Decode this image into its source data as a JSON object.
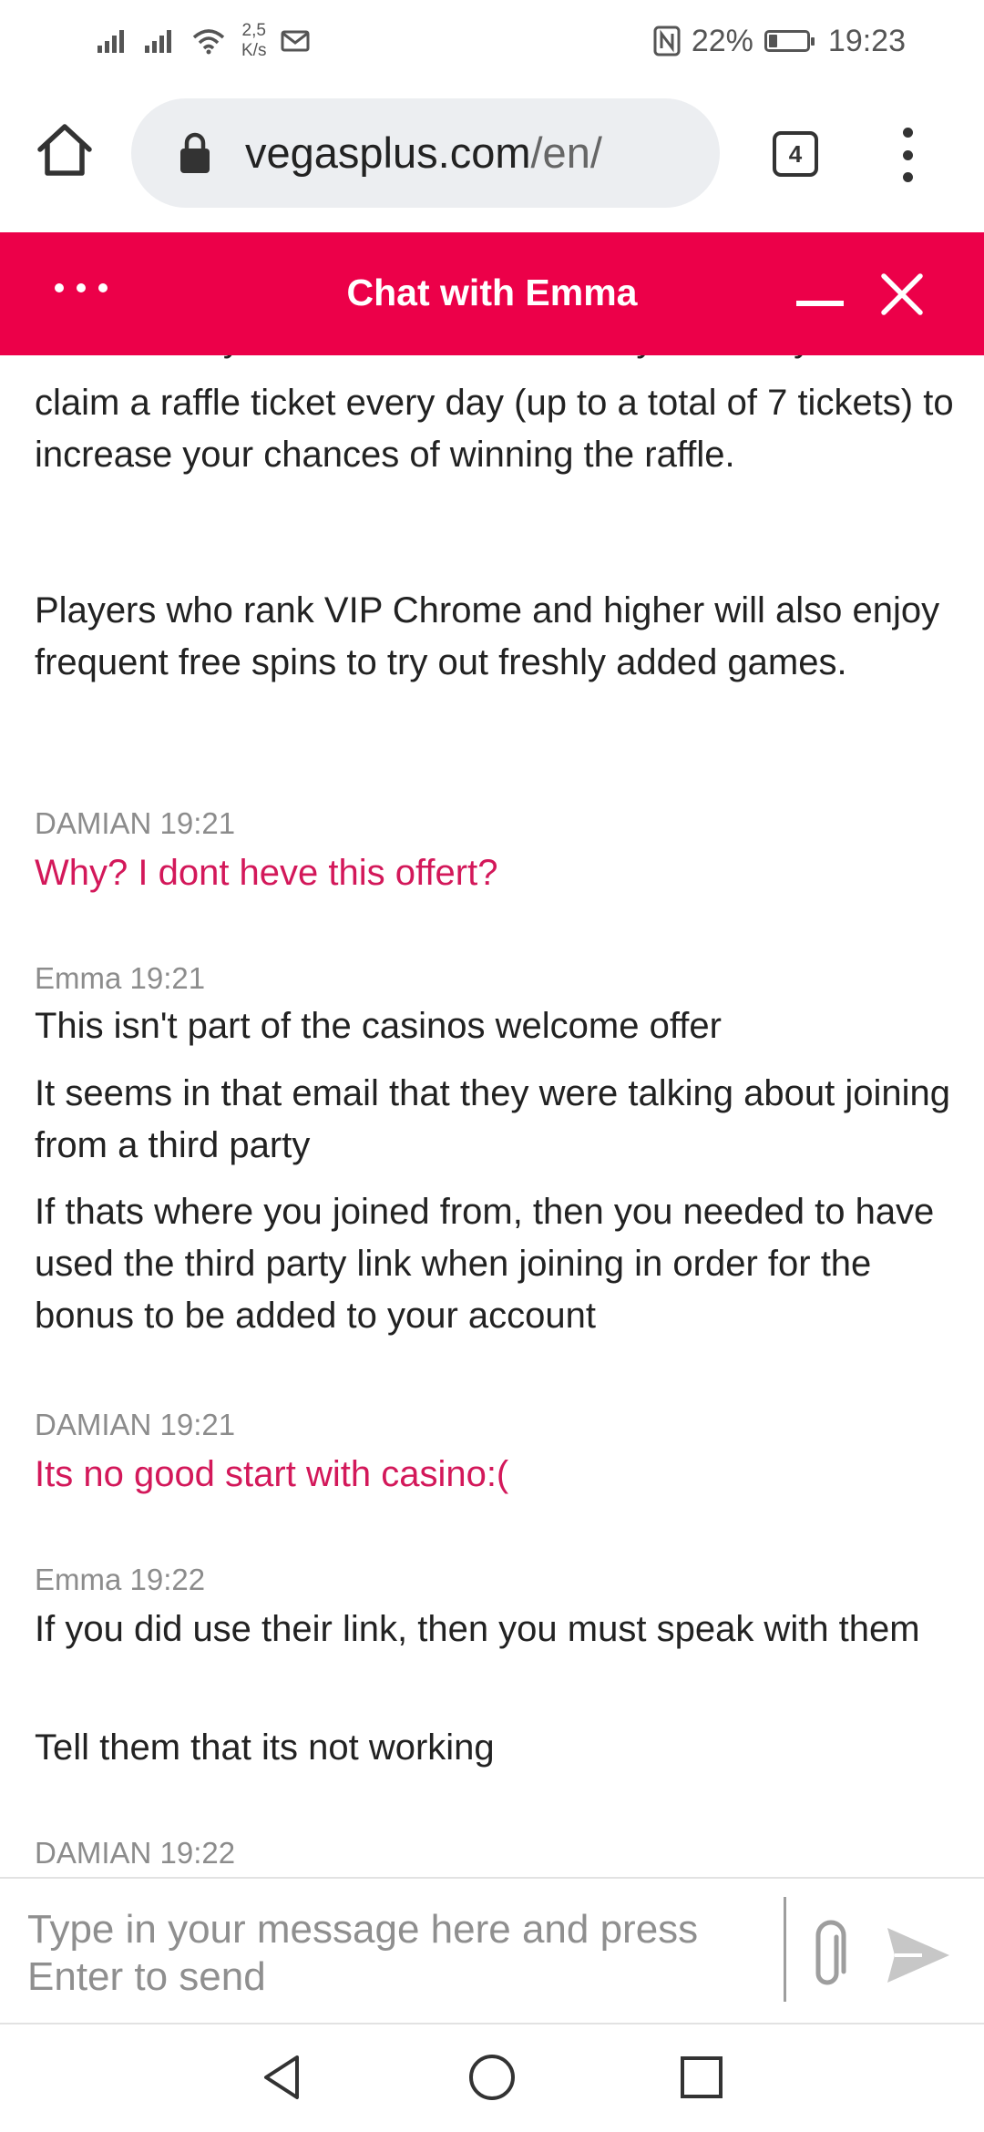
{
  "status_bar": {
    "speed_value": "2,5",
    "speed_unit": "K/s",
    "battery_percent": "22%",
    "battery_level": 0.22,
    "time": "19:23"
  },
  "browser": {
    "url_domain": "vegasplus.com",
    "url_path": "/en/",
    "tab_count": "4"
  },
  "chat": {
    "title": "Chat with Emma",
    "partial_top_line": "is added to your account automatically. You may",
    "blocks": {
      "agent_paragraph_1": "claim a raffle ticket every day (up to a total of 7 tickets) to increase your chances of winning the raffle.",
      "agent_paragraph_2": "Players who rank VIP Chrome and higher will also enjoy frequent free spins to try out freshly added games.",
      "m1_meta": "DAMIAN 19:21",
      "m1_text": "Why? I dont heve this offert?",
      "m2_meta": "Emma 19:21",
      "m2_lines": [
        "This isn't part of the casinos welcome offer",
        "It seems in that email that they were talking about joining from a third party",
        "If thats where you joined from, then you needed to have used the third party link when joining in order for the bonus to be added to your account"
      ],
      "m3_meta": "DAMIAN 19:21",
      "m3_text": "Its no good start with casino:(",
      "m4_meta": "Emma 19:22",
      "m4_lines": [
        "If you did use their link, then you must speak with them",
        "Tell them that its not working"
      ],
      "m5_meta": "DAMIAN 19:22"
    },
    "input_placeholder": "Type in your message here and press Enter to send"
  },
  "colors": {
    "header_bg": "#ec0049",
    "user_text": "#d3185a",
    "meta_text": "#8c8c8c"
  },
  "icons": [
    "signal-icon",
    "wifi-icon",
    "mail-icon",
    "nfc-icon",
    "battery-icon",
    "home-icon",
    "lock-icon",
    "tabs-icon",
    "more-vert-icon",
    "more-horiz-icon",
    "minimize-icon",
    "close-icon",
    "attach-icon",
    "send-icon",
    "back-icon",
    "home-circle-icon",
    "recent-apps-icon"
  ]
}
